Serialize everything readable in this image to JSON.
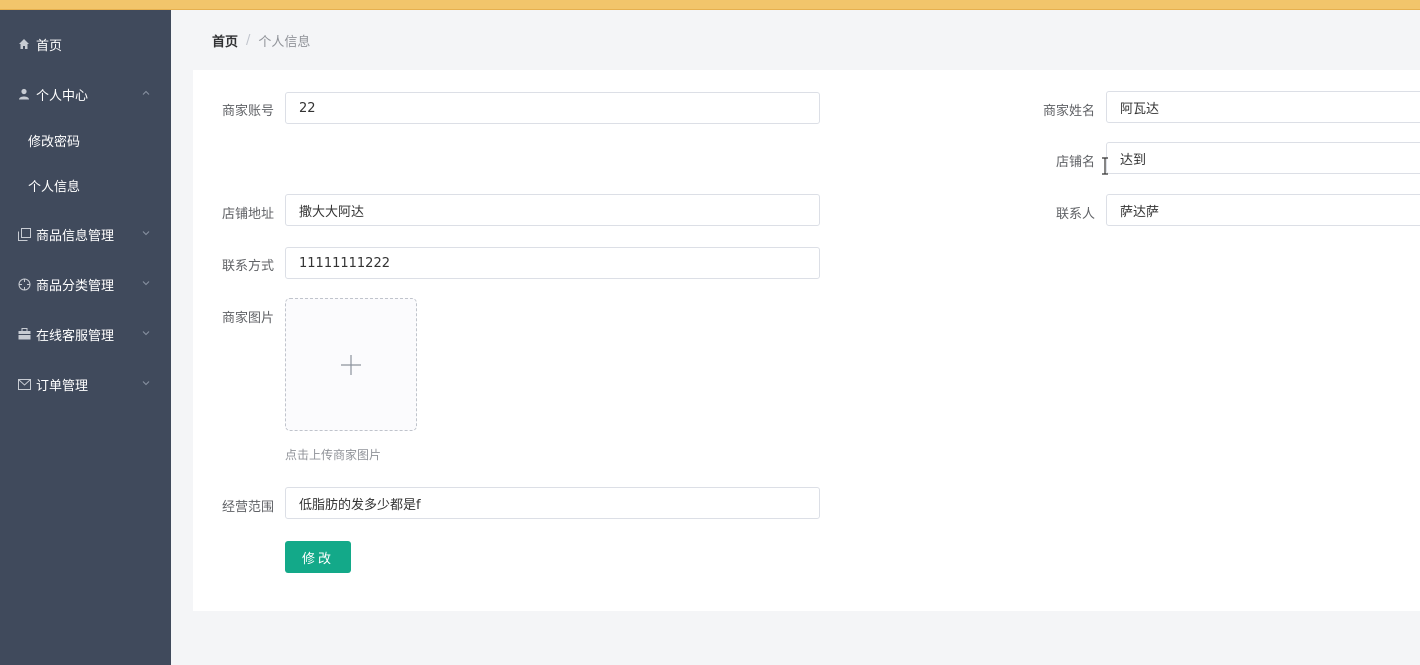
{
  "sidebar": {
    "items": [
      {
        "label": "首页",
        "icon": "home-icon"
      },
      {
        "label": "个人中心",
        "icon": "user-icon",
        "expanded": true,
        "children": [
          {
            "label": "修改密码"
          },
          {
            "label": "个人信息"
          }
        ]
      },
      {
        "label": "商品信息管理",
        "icon": "copy-icon"
      },
      {
        "label": "商品分类管理",
        "icon": "target-icon"
      },
      {
        "label": "在线客服管理",
        "icon": "briefcase-icon"
      },
      {
        "label": "订单管理",
        "icon": "mail-icon"
      }
    ]
  },
  "breadcrumb": {
    "home": "首页",
    "separator": "/",
    "current": "个人信息"
  },
  "form": {
    "account_label": "商家账号",
    "account_value": "22",
    "name_label": "商家姓名",
    "name_value": "阿瓦达",
    "shop_label": "店铺名",
    "shop_value": "达到",
    "address_label": "店铺地址",
    "address_value": "撒大大阿达",
    "contact_person_label": "联系人",
    "contact_person_value": "萨达萨",
    "phone_label": "联系方式",
    "phone_value": "11111111222",
    "image_label": "商家图片",
    "upload_tip": "点击上传商家图片",
    "scope_label": "经营范围",
    "scope_value": "低脂肪的发多少都是f",
    "submit_label": "修改"
  },
  "colors": {
    "sidebar_bg": "#404a5c",
    "accent": "#13a989",
    "top_bar": "#f2c56b"
  }
}
